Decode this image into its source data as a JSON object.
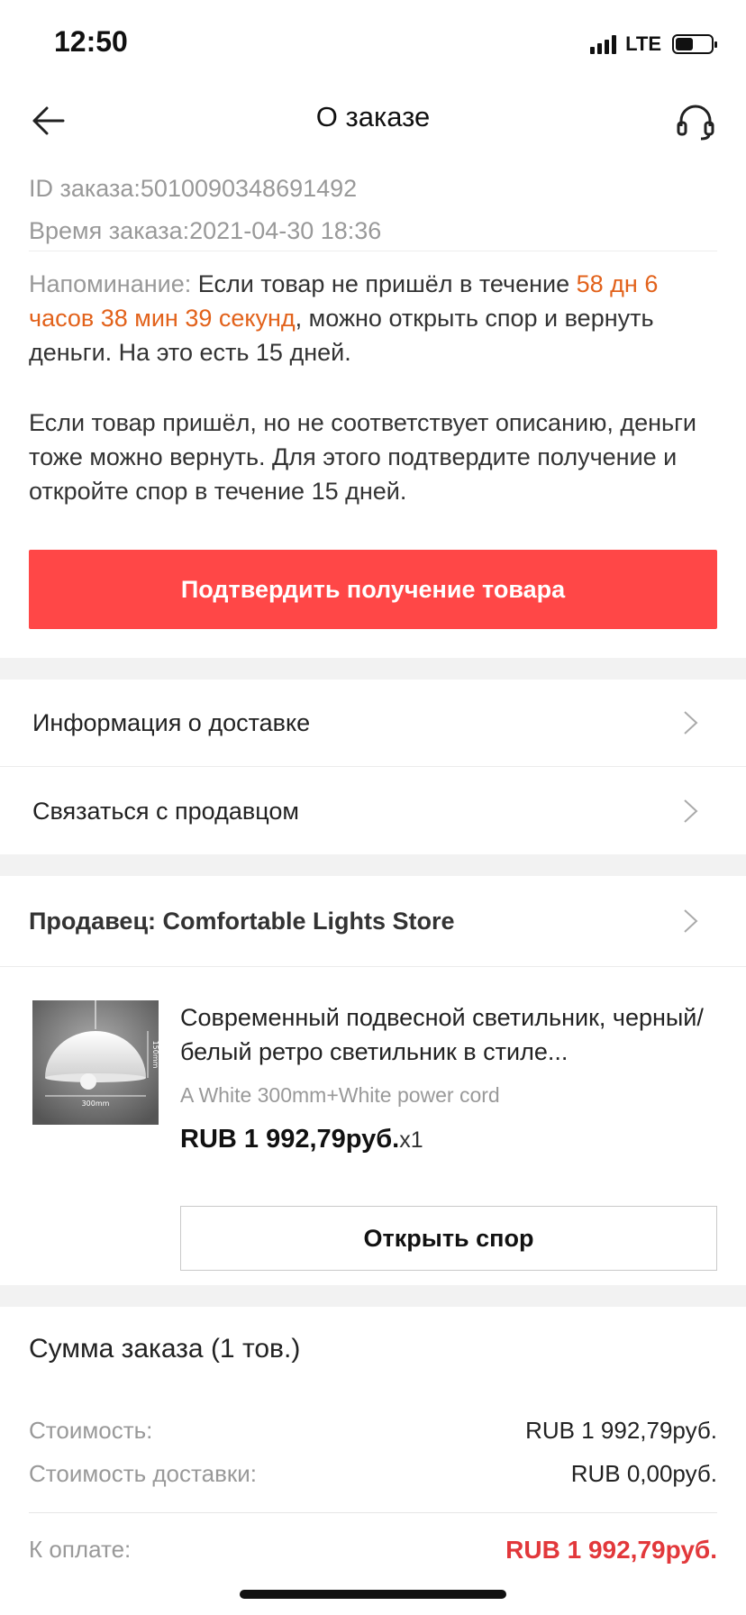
{
  "status_bar": {
    "time": "12:50",
    "network": "LTE",
    "battery_level": 0.5
  },
  "nav": {
    "title": "О заказе",
    "back_icon": "arrow-left-icon",
    "support_icon": "headset-icon"
  },
  "order": {
    "id_line": "ID заказа:5010090348691492",
    "time_line": "Время заказа:2021-04-30 18:36"
  },
  "reminder": {
    "label": "Напоминание: ",
    "text_before": "Если товар не пришёл в течение ",
    "countdown": "58 дн 6 часов 38 мин 39 секунд",
    "text_after": ", можно открыть спор и вернуть деньги. На это есть 15 дней.",
    "second_paragraph": "Если товар пришёл, но не соответствует описанию, деньги тоже можно вернуть. Для этого подтвердите получение и откройте спор в течение 15 дней."
  },
  "confirm_button": "Подтвердить получение товара",
  "menu": {
    "delivery_info": "Информация о доставке",
    "contact_seller": "Связаться с продавцом"
  },
  "seller": {
    "label": "Продавец: Comfortable Lights Store"
  },
  "product": {
    "title": "Современный подвесной светильник, черный/белый ретро светильник в стиле...",
    "sku": "A White 300mm+White power cord",
    "price": "RUB 1 992,79руб.",
    "qty": "x1",
    "image_labels": {
      "height": "150mm",
      "width": "300mm"
    }
  },
  "dispute_button": "Открыть спор",
  "summary": {
    "title": "Сумма заказа (1 тов.)",
    "cost_label": "Стоимость:",
    "cost_value": "RUB 1 992,79руб.",
    "shipping_label": "Стоимость доставки:",
    "shipping_value": "RUB 0,00руб.",
    "total_label": "К оплате:",
    "total_value": "RUB 1 992,79руб."
  },
  "colors": {
    "accent_red": "#ff4747",
    "countdown_orange": "#e2621b",
    "total_red": "#e2383b"
  }
}
